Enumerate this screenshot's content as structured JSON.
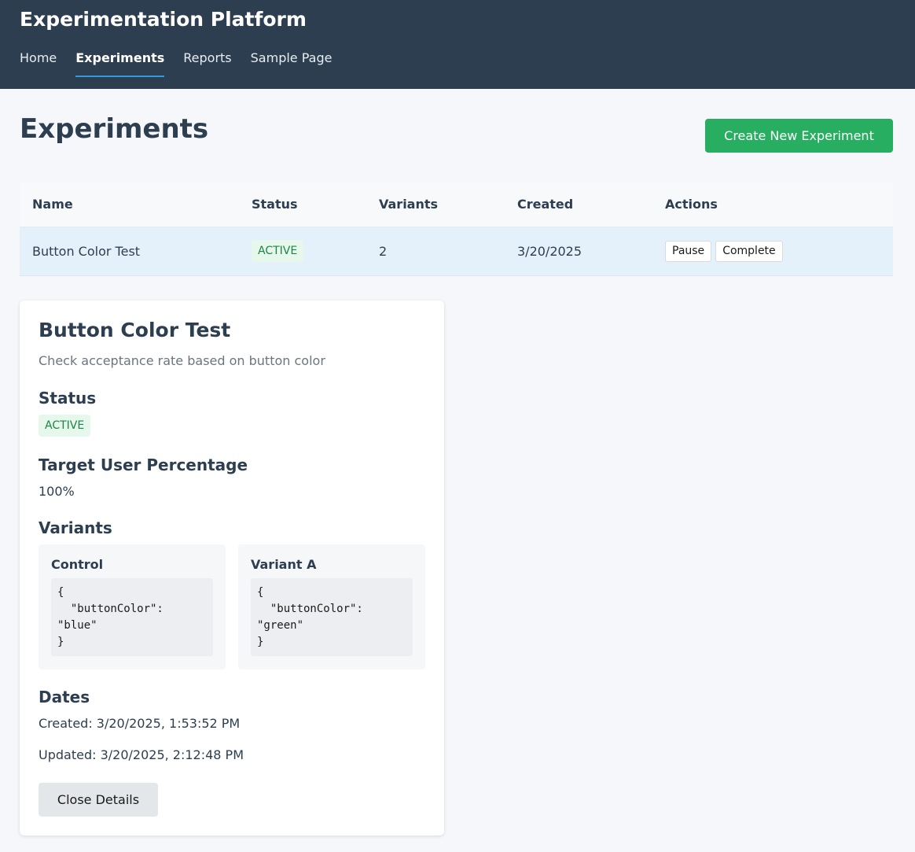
{
  "app": {
    "title": "Experimentation Platform"
  },
  "nav": {
    "items": [
      {
        "label": "Home",
        "active": false
      },
      {
        "label": "Experiments",
        "active": true
      },
      {
        "label": "Reports",
        "active": false
      },
      {
        "label": "Sample Page",
        "active": false
      }
    ]
  },
  "page": {
    "title": "Experiments",
    "create_button": "Create New Experiment"
  },
  "table": {
    "headers": [
      "Name",
      "Status",
      "Variants",
      "Created",
      "Actions"
    ],
    "rows": [
      {
        "name": "Button Color Test",
        "status": "ACTIVE",
        "variants": "2",
        "created": "3/20/2025",
        "actions": [
          "Pause",
          "Complete"
        ]
      }
    ]
  },
  "details": {
    "title": "Button Color Test",
    "description": "Check acceptance rate based on button color",
    "status_heading": "Status",
    "status": "ACTIVE",
    "target_heading": "Target User Percentage",
    "target_value": "100%",
    "variants_heading": "Variants",
    "variants": [
      {
        "name": "Control",
        "config": "{\n  \"buttonColor\":\n\"blue\"\n}"
      },
      {
        "name": "Variant A",
        "config": "{\n  \"buttonColor\":\n\"green\"\n}"
      }
    ],
    "dates_heading": "Dates",
    "created": "Created: 3/20/2025, 1:53:52 PM",
    "updated": "Updated: 3/20/2025, 2:12:48 PM",
    "close_button": "Close Details"
  },
  "colors": {
    "header_bg": "#2c3e50",
    "nav_active_underline": "#3498db",
    "primary_button": "#27ae60",
    "active_badge_bg": "#e6f7ec",
    "active_badge_text": "#1e8449",
    "selected_row_bg": "#e4f1fb"
  }
}
